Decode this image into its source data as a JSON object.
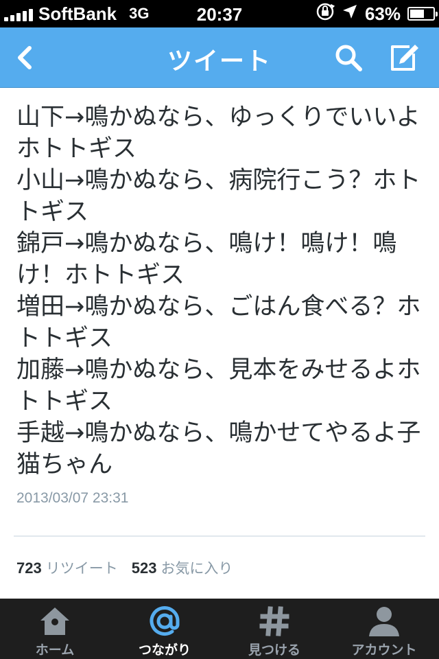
{
  "status_bar": {
    "carrier": "SoftBank",
    "network": "3G",
    "time": "20:37",
    "battery": "63%",
    "battery_level": 0.63
  },
  "nav": {
    "title": "ツイート",
    "icons": [
      "back-chevron-icon",
      "search-icon",
      "compose-icon"
    ]
  },
  "tweet": {
    "text": "山下→鳴かぬなら、ゆっくりでいいよホトトギス\n小山→鳴かぬなら、病院行こう？ホトトギス\n錦戸→鳴かぬなら、鳴け！鳴け！鳴け！ホトトギス\n増田→鳴かぬなら、ごはん食べる？ホトトギス\n加藤→鳴かぬなら、見本をみせるよホトトギス\n手越→鳴かぬなら、鳴かせてやるよ子猫ちゃん",
    "timestamp": "2013/03/07 23:31",
    "retweet_count": "723",
    "retweet_label": "リツイート",
    "favorite_count": "523",
    "favorite_label": "お気に入り"
  },
  "tab_bar": {
    "tabs": [
      {
        "label": "ホーム",
        "icon": "home-icon",
        "active": false
      },
      {
        "label": "つながり",
        "icon": "at-icon",
        "active": true
      },
      {
        "label": "見つける",
        "icon": "hashtag-icon",
        "active": false
      },
      {
        "label": "アカウント",
        "icon": "person-icon",
        "active": false
      }
    ]
  },
  "colors": {
    "nav_background": "#55acee",
    "active_tab_icon": "#55acee",
    "tab_bar_background": "#1e1e1e"
  }
}
